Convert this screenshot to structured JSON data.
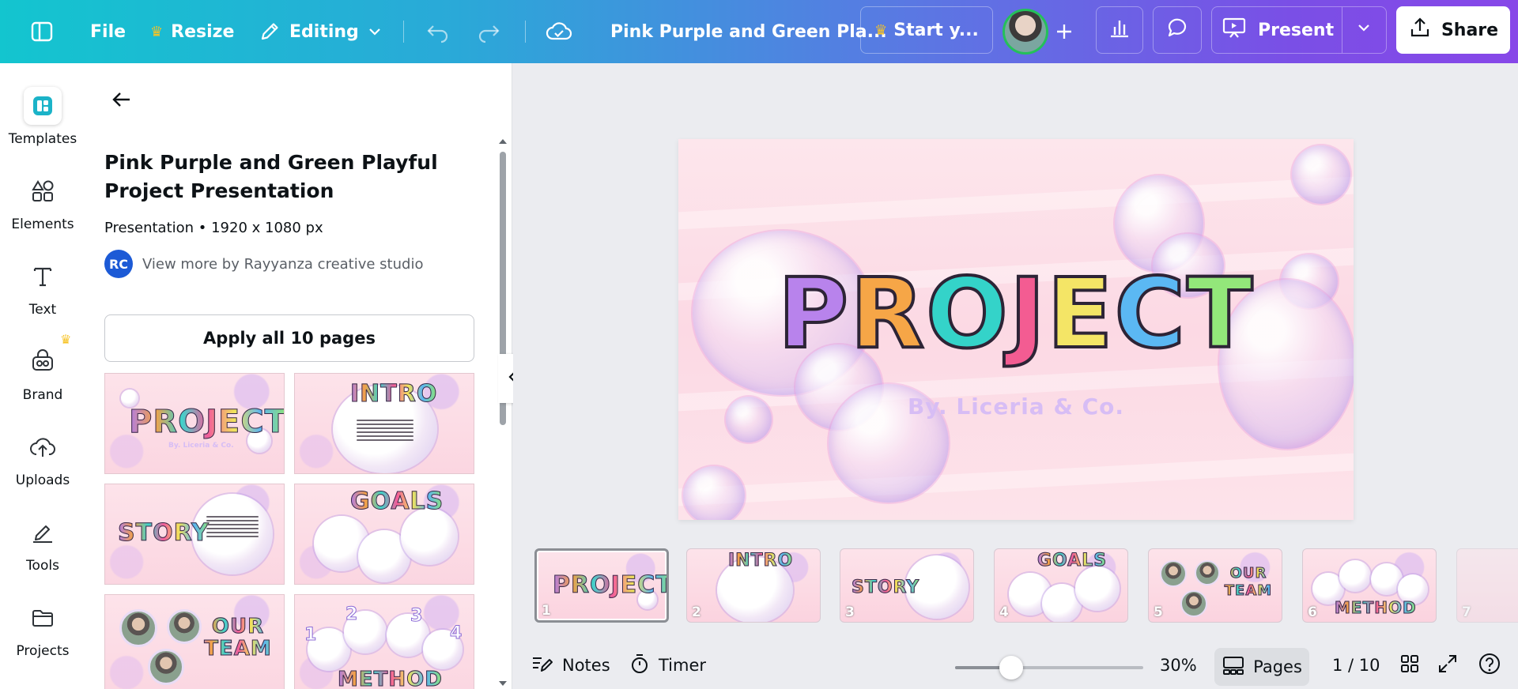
{
  "topbar": {
    "file": "File",
    "resize": "Resize",
    "editing": "Editing",
    "doc_title": "Pink Purple and Green Pla...",
    "start_trial": "Start y...",
    "present": "Present",
    "share": "Share",
    "colors": {
      "gradient_start": "#13c5cf",
      "gradient_end": "#8747e8",
      "crown": "#f7c325"
    }
  },
  "rail": {
    "items": [
      {
        "label": "Templates",
        "icon": "templates-icon"
      },
      {
        "label": "Elements",
        "icon": "elements-icon"
      },
      {
        "label": "Text",
        "icon": "text-icon"
      },
      {
        "label": "Brand",
        "icon": "brand-icon"
      },
      {
        "label": "Uploads",
        "icon": "uploads-icon"
      },
      {
        "label": "Tools",
        "icon": "tools-icon"
      },
      {
        "label": "Projects",
        "icon": "projects-icon"
      }
    ]
  },
  "panel": {
    "title": "Pink Purple and Green Playful Project Presentation",
    "meta": "Presentation • 1920 x 1080 px",
    "author_initials": "RC",
    "author_link": "View more by Rayyanza creative studio",
    "apply_button": "Apply all 10 pages",
    "thumbs": [
      {
        "word": "PROJECT",
        "sub": "By. Liceria & Co."
      },
      {
        "word": "INTRO"
      },
      {
        "word": "STORY"
      },
      {
        "word": "GOALS"
      },
      {
        "word": "OUR TEAM"
      },
      {
        "word": "METHOD",
        "nums": [
          "1",
          "2",
          "3",
          "4"
        ]
      }
    ]
  },
  "slide": {
    "title_letters": [
      "P",
      "R",
      "O",
      "J",
      "E",
      "C",
      "T"
    ],
    "letter_colors": [
      "#b883ec",
      "#f6a647",
      "#34d3c9",
      "#f35c92",
      "#f4e566",
      "#5bb8f3",
      "#93e77a"
    ],
    "subtitle": "By. Liceria & Co."
  },
  "pages": {
    "items": [
      {
        "num": "1",
        "word": "PROJECT"
      },
      {
        "num": "2",
        "word": "INTRO"
      },
      {
        "num": "3",
        "word": "STORY"
      },
      {
        "num": "4",
        "word": "GOALS"
      },
      {
        "num": "5",
        "word": "OUR TEAM"
      },
      {
        "num": "6",
        "word": "METHOD"
      },
      {
        "num": "7",
        "word": ""
      }
    ]
  },
  "bottombar": {
    "notes": "Notes",
    "timer": "Timer",
    "zoom": "30%",
    "zoom_level": 0.3,
    "pages": "Pages",
    "page_counter": "1 / 10"
  }
}
